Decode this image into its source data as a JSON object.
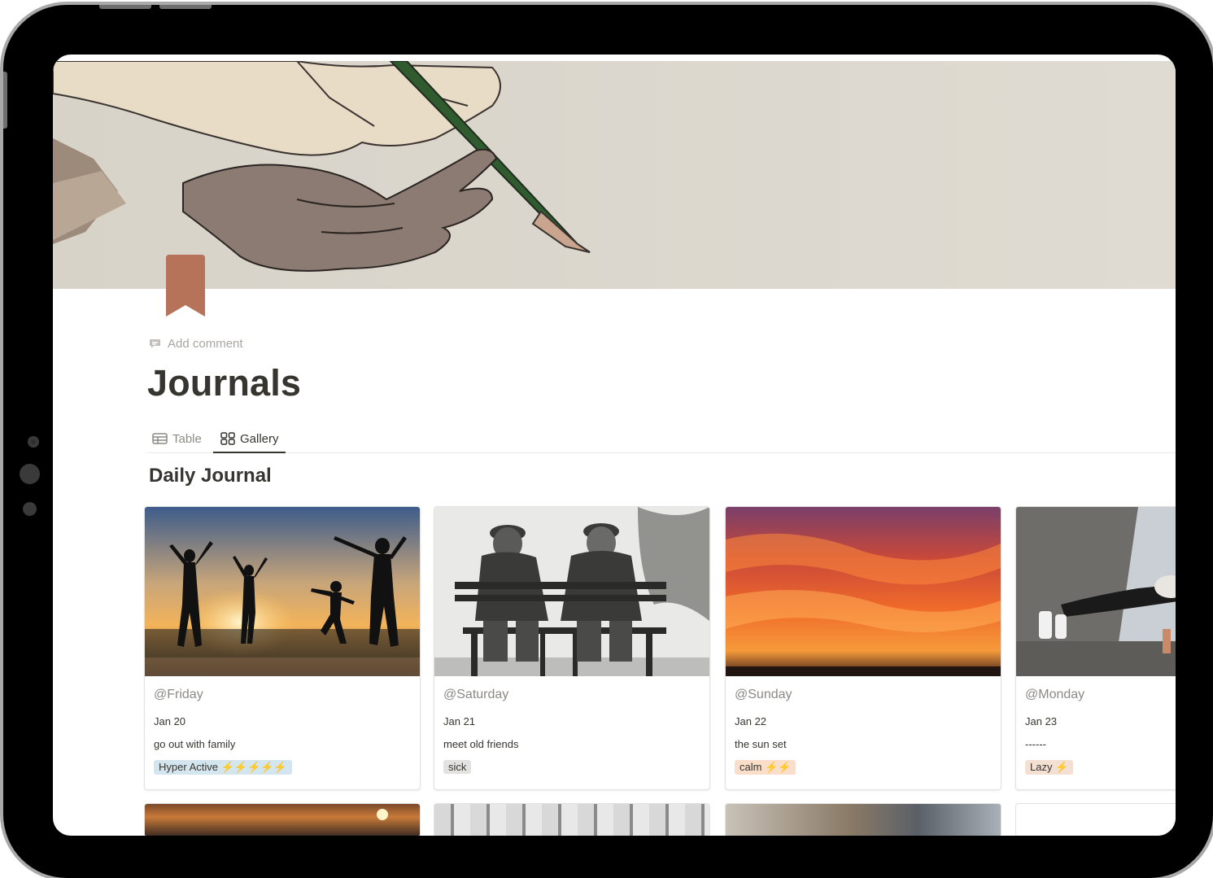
{
  "page": {
    "add_comment": "Add comment",
    "title": "Journals"
  },
  "tabs": [
    {
      "label": "Table",
      "icon": "table-icon",
      "active": false
    },
    {
      "label": "Gallery",
      "icon": "gallery-grid-icon",
      "active": true
    }
  ],
  "view": {
    "title": "Daily Journal"
  },
  "cards": [
    {
      "day": "@Friday",
      "date": "Jan 20",
      "note": "go out with family",
      "tag": "Hyper Active",
      "bolts": "⚡⚡⚡⚡⚡",
      "tag_color": "#d3e5ef",
      "image": "family silhouettes at beach sunset"
    },
    {
      "day": "@Saturday",
      "date": "Jan 21",
      "note": "meet old friends",
      "tag": "sick",
      "bolts": "",
      "tag_color": "#e3e2e0",
      "image": "two old men on a bench"
    },
    {
      "day": "@Sunday",
      "date": "Jan 22",
      "note": "the sun set",
      "tag": "calm",
      "bolts": "⚡⚡",
      "tag_color": "#fadec9",
      "image": "orange sunset sky"
    },
    {
      "day": "@Monday",
      "date": "Jan 23",
      "note": "------",
      "tag": "Lazy",
      "bolts": "⚡",
      "tag_color": "#f4dfd3",
      "image": "person doing push-up"
    }
  ],
  "colors": {
    "text": "#37352f",
    "muted": "#8c8a86",
    "bookmark": "#b7735a",
    "frame": "#000000"
  }
}
